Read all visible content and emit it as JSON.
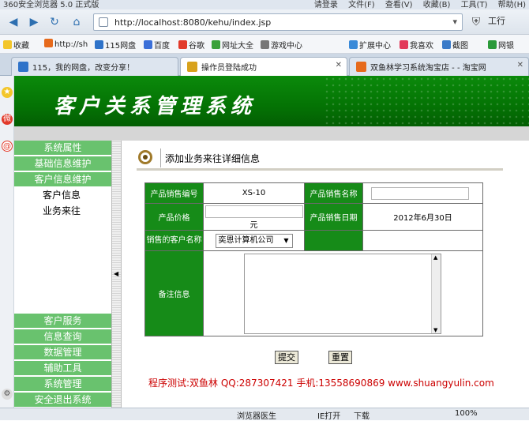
{
  "browser": {
    "app_title": "360安全浏览器 5.0 正式版",
    "menus": [
      "请登录",
      "文件(F)",
      "查看(V)",
      "收藏(B)",
      "工具(T)",
      "帮助(H)"
    ],
    "url": "http://localhost:8080/kehu/index.jsp",
    "tools_label": "工行",
    "favorites": [
      "收藏",
      "http://sh",
      "115网盘",
      "百度",
      "谷歌",
      "网址大全",
      "游戏中心",
      "扩展中心",
      "我喜欢",
      "截图",
      "网银"
    ],
    "tabs": [
      {
        "label": "115，我的网盘，改变分享！",
        "active": false
      },
      {
        "label": "操作员登陆成功",
        "active": true
      },
      {
        "label": "双鱼林学习系统淘宝店 - - 淘宝网",
        "active": false
      }
    ],
    "status": {
      "doctor": "浏览器医生",
      "ie": "IE打开",
      "download": "下载",
      "zoom": "100%"
    }
  },
  "app": {
    "title": "客户关系管理系统",
    "menu": {
      "top": [
        "系统属性",
        "基础信息维护",
        "客户信息维护"
      ],
      "sub": [
        "客户信息",
        "业务来往"
      ],
      "bottom": [
        "客户服务",
        "信息查询",
        "数据管理",
        "辅助工具",
        "系统管理",
        "安全退出系统"
      ]
    },
    "section_title": "添加业务来往详细信息",
    "form": {
      "product_id_label": "产品销售编号",
      "product_id_value": "XS-10",
      "product_name_label": "产品销售名称",
      "price_label": "产品价格",
      "price_unit": "元",
      "sale_date_label": "产品销售日期",
      "sale_date_value": "2012年6月30日",
      "customer_label": "销售的客户名称",
      "customer_value": "奕恩计算机公司",
      "remark_label": "备注信息"
    },
    "buttons": {
      "submit": "提交",
      "reset": "重置"
    },
    "footer": "程序测试:双鱼林 QQ:287307421 手机:13558690869 www.shuangyulin.com"
  }
}
